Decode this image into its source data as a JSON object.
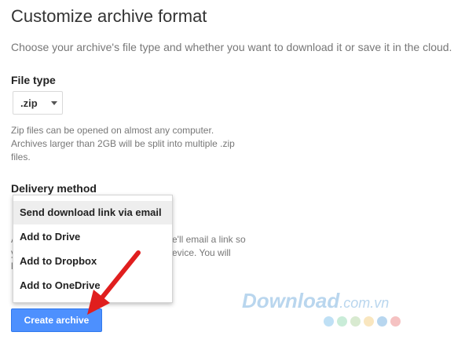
{
  "header": {
    "title": "Customize archive format",
    "subtitle": "Choose your archive's file type and whether you want to download it or save it in the cloud."
  },
  "file_type": {
    "label": "File type",
    "selected_value": ".zip",
    "help_text": "Zip files can be opened on almost any computer. Archives larger than 2GB will be split into multiple .zip files."
  },
  "delivery": {
    "label": "Delivery method",
    "obscured_text": {
      "line1_prefix": "A",
      "line1_suffix": "e'll email a link so",
      "line2_prefix": "y",
      "line2_suffix": "evice. You will",
      "line3_prefix": "l"
    },
    "options": [
      {
        "label": "Send download link via email",
        "selected": true
      },
      {
        "label": "Add to Drive",
        "selected": false
      },
      {
        "label": "Add to Dropbox",
        "selected": false
      },
      {
        "label": "Add to OneDrive",
        "selected": false
      }
    ]
  },
  "actions": {
    "create_label": "Create archive"
  },
  "watermark": {
    "brand": "Download",
    "suffix": ".com.vn",
    "dot_colors": [
      "#bfe0f5",
      "#c9ecd8",
      "#d8ead0",
      "#f9e6bf",
      "#b7d6ef",
      "#f5c2c2"
    ]
  },
  "colors": {
    "primary_button": "#4d90fe",
    "annotation_arrow": "#e01e1e"
  }
}
